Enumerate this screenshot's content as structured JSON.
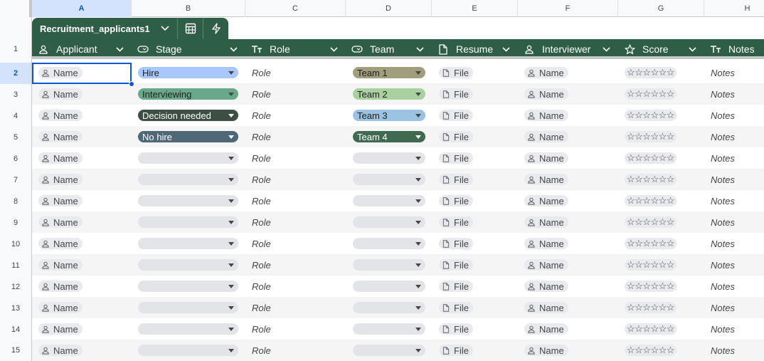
{
  "columns": [
    "A",
    "B",
    "C",
    "D",
    "E",
    "F",
    "G",
    "H"
  ],
  "rows": [
    "1",
    "2",
    "3",
    "4",
    "5",
    "6",
    "7",
    "8",
    "9",
    "10",
    "11",
    "12",
    "13",
    "14",
    "15"
  ],
  "table": {
    "name": "Recruitment_applicants1",
    "icons": [
      "chevron-down-icon",
      "calculator-icon",
      "lightning-icon"
    ],
    "headers": [
      {
        "label": "Applicant",
        "icon": "person-icon"
      },
      {
        "label": "Stage",
        "icon": "dropdown-chip-icon"
      },
      {
        "label": "Role",
        "icon": "text-icon"
      },
      {
        "label": "Team",
        "icon": "dropdown-chip-icon"
      },
      {
        "label": "Resume",
        "icon": "file-icon"
      },
      {
        "label": "Interviewer",
        "icon": "person-icon"
      },
      {
        "label": "Score",
        "icon": "star-icon"
      },
      {
        "label": "Notes",
        "icon": "text-icon"
      }
    ],
    "placeholders": {
      "applicant": "Name",
      "role": "Role",
      "resume": "File",
      "interviewer": "Name",
      "score": "☆☆☆☆☆☆",
      "notes": "Notes"
    },
    "stage_values": [
      "Hire",
      "Interviewing",
      "Decision needed",
      "No hire",
      "",
      "",
      "",
      "",
      "",
      "",
      "",
      "",
      "",
      ""
    ],
    "team_values": [
      "Team 1",
      "Team 2",
      "Team 3",
      "Team 4",
      "",
      "",
      "",
      "",
      "",
      "",
      "",
      "",
      "",
      ""
    ]
  },
  "colors": {
    "header_bg": "#2e5e45",
    "stage": {
      "Hire": "#a8c7fa",
      "Interviewing": "#6aa88a",
      "Decision needed": "#3d4f45",
      "No hire": "#4f6878",
      "": "#e2e4e7"
    },
    "team": {
      "Team 1": "#a09e7c",
      "Team 2": "#a8d19f",
      "Team 3": "#9bc1e3",
      "Team 4": "#3f6a4f",
      "": "#e2e4e7"
    },
    "selection": "#0b57d0"
  },
  "selected_cell": "A2"
}
